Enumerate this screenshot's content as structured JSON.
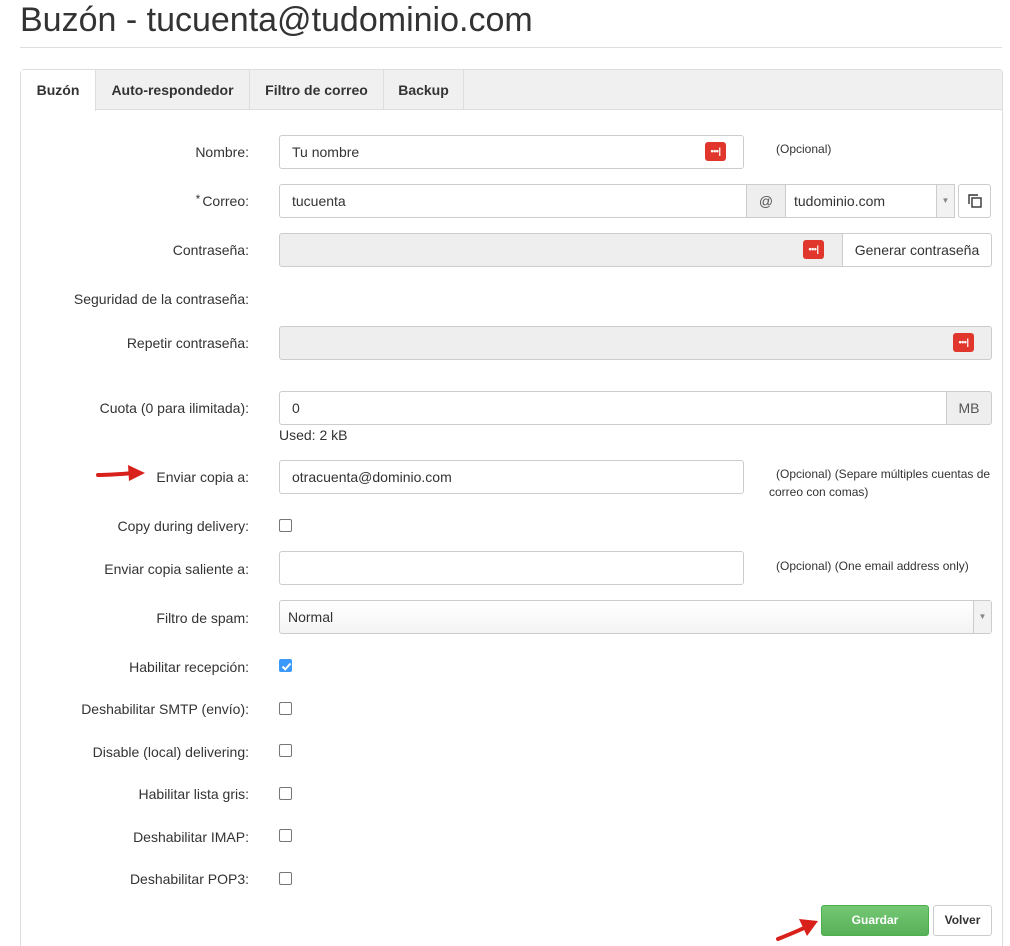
{
  "page": {
    "title": "Buzón - tucuenta@tudominio.com"
  },
  "tabs": [
    {
      "label": "Buzón",
      "active": true
    },
    {
      "label": "Auto-respondedor",
      "active": false
    },
    {
      "label": "Filtro de correo",
      "active": false
    },
    {
      "label": "Backup",
      "active": false
    }
  ],
  "form": {
    "nombre": {
      "label": "Nombre:",
      "value": "Tu nombre",
      "help": "(Opcional)"
    },
    "correo": {
      "required_mark": "*",
      "label": "Correo:",
      "local": "tucuenta",
      "at": "@",
      "domain": "tudominio.com"
    },
    "contrasena": {
      "label": "Contraseña:",
      "value": "",
      "generate_label": "Generar contraseña"
    },
    "seguridad": {
      "label": "Seguridad de la contraseña:"
    },
    "repetir": {
      "label": "Repetir contraseña:",
      "value": ""
    },
    "cuota": {
      "label": "Cuota (0 para ilimitada):",
      "value": "0",
      "unit": "MB",
      "used": "Used: 2 kB"
    },
    "copia": {
      "label": "Enviar copia a:",
      "value": "otracuenta@dominio.com",
      "help_line1": "(Opcional) (Separe múltiples cuentas de",
      "help_line2": "correo con comas)"
    },
    "copy_during": {
      "label": "Copy during delivery:",
      "checked": false
    },
    "copia_saliente": {
      "label": "Enviar copia saliente a:",
      "value": "",
      "help": "(Opcional) (One email address only)"
    },
    "spam": {
      "label": "Filtro de spam:",
      "value": "Normal"
    },
    "recepcion": {
      "label": "Habilitar recepción:",
      "checked": true
    },
    "smtp": {
      "label": "Deshabilitar SMTP (envío):",
      "checked": false
    },
    "local_deliver": {
      "label": "Disable (local) delivering:",
      "checked": false
    },
    "gris": {
      "label": "Habilitar lista gris:",
      "checked": false
    },
    "imap": {
      "label": "Deshabilitar IMAP:",
      "checked": false
    },
    "pop3": {
      "label": "Deshabilitar POP3:",
      "checked": false
    }
  },
  "actions": {
    "save_label": "Guardar",
    "back_label": "Volver"
  },
  "colors": {
    "save": "#5cb85c",
    "pw_icon": "#e0362c",
    "arrow": "#d9211c",
    "checkbox_on": "#3b99fc"
  },
  "icons": {
    "password_manager": "password-dots-icon",
    "copy": "copy-icon",
    "annotation": "red-arrow-icon"
  }
}
